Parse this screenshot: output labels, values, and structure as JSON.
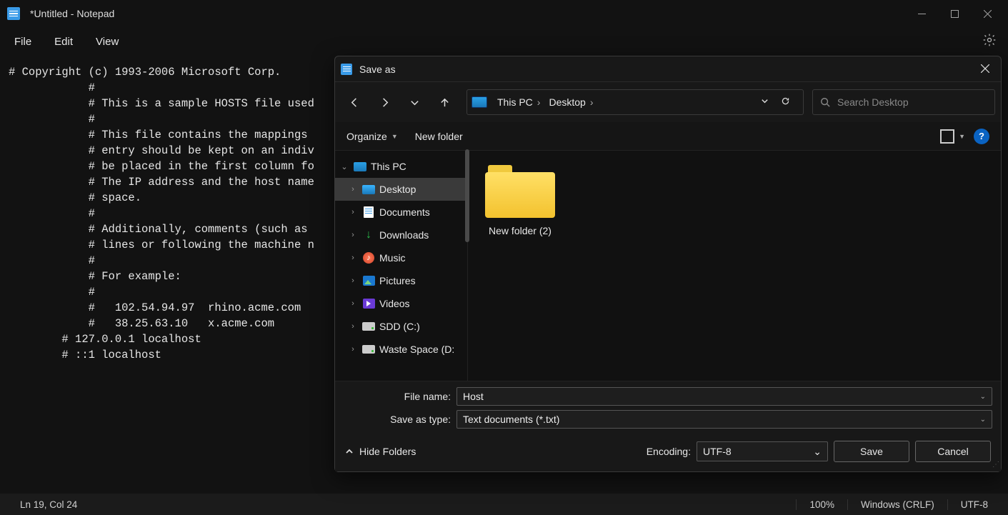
{
  "window": {
    "title": "*Untitled - Notepad"
  },
  "menu": {
    "file": "File",
    "edit": "Edit",
    "view": "View"
  },
  "editor_text": "# Copyright (c) 1993-2006 Microsoft Corp.\n            #\n            # This is a sample HOSTS file used\n            #\n            # This file contains the mappings \n            # entry should be kept on an indiv\n            # be placed in the first column fo\n            # The IP address and the host name\n            # space.\n            #\n            # Additionally, comments (such as \n            # lines or following the machine n\n            #\n            # For example:\n            #\n            #   102.54.94.97  rhino.acme.com\n            #   38.25.63.10   x.acme.com\n        # 127.0.0.1 localhost\n        # ::1 localhost",
  "status": {
    "cursor": "Ln 19, Col 24",
    "zoom": "100%",
    "eol": "Windows (CRLF)",
    "encoding": "UTF-8"
  },
  "dialog": {
    "title": "Save as",
    "breadcrumb": {
      "root": "This PC",
      "loc": "Desktop"
    },
    "search_placeholder": "Search Desktop",
    "toolbar": {
      "organize": "Organize",
      "newfolder": "New folder"
    },
    "tree": {
      "root": "This PC",
      "items": [
        "Desktop",
        "Documents",
        "Downloads",
        "Music",
        "Pictures",
        "Videos",
        "SDD (C:)",
        "Waste Space (D:"
      ]
    },
    "file_item": "New folder (2)",
    "labels": {
      "filename": "File name:",
      "saveastype": "Save as type:",
      "encoding": "Encoding:",
      "hidefolders": "Hide Folders",
      "save": "Save",
      "cancel": "Cancel"
    },
    "values": {
      "filename": "Host",
      "saveastype": "Text documents (*.txt)",
      "encoding": "UTF-8"
    }
  }
}
